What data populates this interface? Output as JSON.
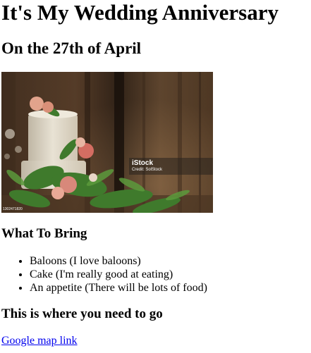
{
  "page": {
    "title": "It's My Wedding Anniversary",
    "subtitle": "On the 27th of April"
  },
  "photo": {
    "subject": "wedding cake decorated with flowers",
    "watermark": {
      "logo": "iStock",
      "credit": "Credit: SolStock"
    },
    "corner_id": "1302471820"
  },
  "bring": {
    "heading": "What To Bring",
    "items": [
      {
        "label": "Baloons (I love baloons)"
      },
      {
        "label": "Cake (I'm really good at eating)"
      },
      {
        "label": "An appetite (There will be lots of food)"
      }
    ]
  },
  "location": {
    "heading": "This is where you need to go",
    "link_text": "Google map link"
  },
  "colors": {
    "link": "#0000ee",
    "text": "#000000",
    "background": "#ffffff"
  }
}
